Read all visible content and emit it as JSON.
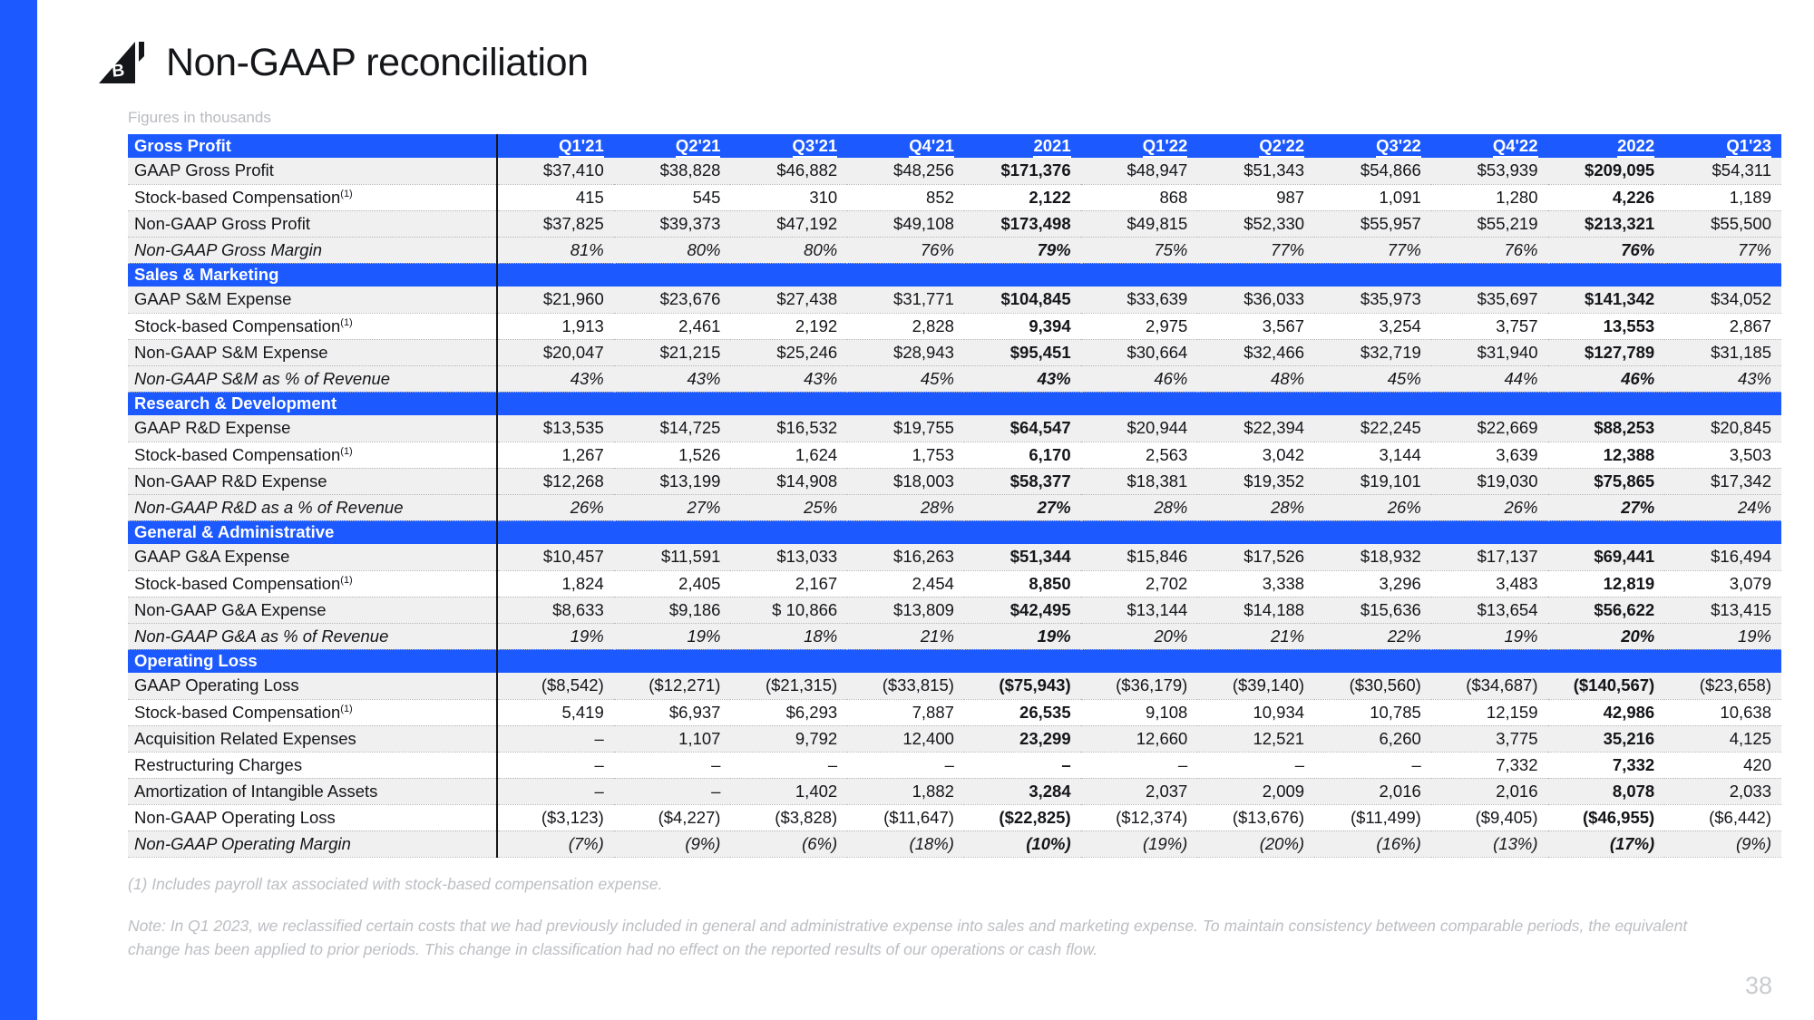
{
  "brand": {
    "accent": "#1C59FF",
    "text": "#15161A",
    "muted": "#bcbec3"
  },
  "header": {
    "title": "Non-GAAP reconciliation",
    "logo_name": "braze-logo",
    "figures_note": "Figures in thousands"
  },
  "columns": [
    "Q1'21",
    "Q2'21",
    "Q3'21",
    "Q4'21",
    "2021",
    "Q1'22",
    "Q2'22",
    "Q3'22",
    "Q4'22",
    "2022",
    "Q1'23"
  ],
  "bold_columns": [
    4,
    9
  ],
  "sections": [
    {
      "title": "Gross Profit",
      "rows": [
        {
          "label": "GAAP Gross Profit",
          "footnote": "",
          "italic": false,
          "shaded": true,
          "values": [
            "$37,410",
            "$38,828",
            "$46,882",
            "$48,256",
            "$171,376",
            "$48,947",
            "$51,343",
            "$54,866",
            "$53,939",
            "$209,095",
            "$54,311"
          ]
        },
        {
          "label": "Stock-based Compensation",
          "footnote": "(1)",
          "italic": false,
          "shaded": false,
          "values": [
            "415",
            "545",
            "310",
            "852",
            "2,122",
            "868",
            "987",
            "1,091",
            "1,280",
            "4,226",
            "1,189"
          ]
        },
        {
          "label": "Non-GAAP Gross Profit",
          "footnote": "",
          "italic": false,
          "shaded": true,
          "values": [
            "$37,825",
            "$39,373",
            "$47,192",
            "$49,108",
            "$173,498",
            "$49,815",
            "$52,330",
            "$55,957",
            "$55,219",
            "$213,321",
            "$55,500"
          ]
        },
        {
          "label": "Non-GAAP Gross Margin",
          "footnote": "",
          "italic": true,
          "shaded": true,
          "values": [
            "81%",
            "80%",
            "80%",
            "76%",
            "79%",
            "75%",
            "77%",
            "77%",
            "76%",
            "76%",
            "77%"
          ]
        }
      ]
    },
    {
      "title": "Sales & Marketing",
      "rows": [
        {
          "label": "GAAP S&M Expense",
          "footnote": "",
          "italic": false,
          "shaded": true,
          "values": [
            "$21,960",
            "$23,676",
            "$27,438",
            "$31,771",
            "$104,845",
            "$33,639",
            "$36,033",
            "$35,973",
            "$35,697",
            "$141,342",
            "$34,052"
          ]
        },
        {
          "label": "Stock-based Compensation",
          "footnote": "(1)",
          "italic": false,
          "shaded": false,
          "values": [
            "1,913",
            "2,461",
            "2,192",
            "2,828",
            "9,394",
            "2,975",
            "3,567",
            "3,254",
            "3,757",
            "13,553",
            "2,867"
          ]
        },
        {
          "label": "Non-GAAP S&M Expense",
          "footnote": "",
          "italic": false,
          "shaded": true,
          "values": [
            "$20,047",
            "$21,215",
            "$25,246",
            "$28,943",
            "$95,451",
            "$30,664",
            "$32,466",
            "$32,719",
            "$31,940",
            "$127,789",
            "$31,185"
          ]
        },
        {
          "label": "Non-GAAP S&M as % of Revenue",
          "footnote": "",
          "italic": true,
          "shaded": true,
          "values": [
            "43%",
            "43%",
            "43%",
            "45%",
            "43%",
            "46%",
            "48%",
            "45%",
            "44%",
            "46%",
            "43%"
          ]
        }
      ]
    },
    {
      "title": "Research & Development",
      "rows": [
        {
          "label": "GAAP R&D Expense",
          "footnote": "",
          "italic": false,
          "shaded": true,
          "values": [
            "$13,535",
            "$14,725",
            "$16,532",
            "$19,755",
            "$64,547",
            "$20,944",
            "$22,394",
            "$22,245",
            "$22,669",
            "$88,253",
            "$20,845"
          ]
        },
        {
          "label": "Stock-based Compensation",
          "footnote": "(1)",
          "italic": false,
          "shaded": false,
          "values": [
            "1,267",
            "1,526",
            "1,624",
            "1,753",
            "6,170",
            "2,563",
            "3,042",
            "3,144",
            "3,639",
            "12,388",
            "3,503"
          ]
        },
        {
          "label": "Non-GAAP R&D Expense",
          "footnote": "",
          "italic": false,
          "shaded": true,
          "values": [
            "$12,268",
            "$13,199",
            "$14,908",
            "$18,003",
            "$58,377",
            "$18,381",
            "$19,352",
            "$19,101",
            "$19,030",
            "$75,865",
            "$17,342"
          ]
        },
        {
          "label": "Non-GAAP R&D as a % of Revenue",
          "footnote": "",
          "italic": true,
          "shaded": true,
          "values": [
            "26%",
            "27%",
            "25%",
            "28%",
            "27%",
            "28%",
            "28%",
            "26%",
            "26%",
            "27%",
            "24%"
          ]
        }
      ]
    },
    {
      "title": "General & Administrative",
      "rows": [
        {
          "label": "GAAP G&A Expense",
          "footnote": "",
          "italic": false,
          "shaded": true,
          "values": [
            "$10,457",
            "$11,591",
            "$13,033",
            "$16,263",
            "$51,344",
            "$15,846",
            "$17,526",
            "$18,932",
            "$17,137",
            "$69,441",
            "$16,494"
          ]
        },
        {
          "label": "Stock-based Compensation",
          "footnote": "(1)",
          "italic": false,
          "shaded": false,
          "values": [
            "1,824",
            "2,405",
            "2,167",
            "2,454",
            "8,850",
            "2,702",
            "3,338",
            "3,296",
            "3,483",
            "12,819",
            "3,079"
          ]
        },
        {
          "label": "Non-GAAP G&A Expense",
          "footnote": "",
          "italic": false,
          "shaded": true,
          "values": [
            "$8,633",
            "$9,186",
            "$ 10,866",
            "$13,809",
            "$42,495",
            "$13,144",
            "$14,188",
            "$15,636",
            "$13,654",
            "$56,622",
            "$13,415"
          ]
        },
        {
          "label": "Non-GAAP G&A as % of Revenue",
          "footnote": "",
          "italic": true,
          "shaded": true,
          "values": [
            "19%",
            "19%",
            "18%",
            "21%",
            "19%",
            "20%",
            "21%",
            "22%",
            "19%",
            "20%",
            "19%"
          ]
        }
      ]
    },
    {
      "title": "Operating Loss",
      "rows": [
        {
          "label": "GAAP Operating Loss",
          "footnote": "",
          "italic": false,
          "shaded": true,
          "values": [
            "($8,542)",
            "($12,271)",
            "($21,315)",
            "($33,815)",
            "($75,943)",
            "($36,179)",
            "($39,140)",
            "($30,560)",
            "($34,687)",
            "($140,567)",
            "($23,658)"
          ]
        },
        {
          "label": "Stock-based Compensation",
          "footnote": "(1)",
          "italic": false,
          "shaded": false,
          "values": [
            "5,419",
            "$6,937",
            "$6,293",
            "7,887",
            "26,535",
            "9,108",
            "10,934",
            "10,785",
            "12,159",
            "42,986",
            "10,638"
          ]
        },
        {
          "label": "Acquisition Related Expenses",
          "footnote": "",
          "italic": false,
          "shaded": true,
          "values": [
            "–",
            "1,107",
            "9,792",
            "12,400",
            "23,299",
            "12,660",
            "12,521",
            "6,260",
            "3,775",
            "35,216",
            "4,125"
          ]
        },
        {
          "label": "Restructuring Charges",
          "footnote": "",
          "italic": false,
          "shaded": false,
          "values": [
            "–",
            "–",
            "–",
            "–",
            "–",
            "–",
            "–",
            "–",
            "7,332",
            "7,332",
            "420"
          ]
        },
        {
          "label": "Amortization of Intangible Assets",
          "footnote": "",
          "italic": false,
          "shaded": true,
          "values": [
            "–",
            "–",
            "1,402",
            "1,882",
            "3,284",
            "2,037",
            "2,009",
            "2,016",
            "2,016",
            "8,078",
            "2,033"
          ]
        },
        {
          "label": "Non-GAAP Operating Loss",
          "footnote": "",
          "italic": false,
          "shaded": false,
          "values": [
            "($3,123)",
            "($4,227)",
            "($3,828)",
            "($11,647)",
            "($22,825)",
            "($12,374)",
            "($13,676)",
            "($11,499)",
            "($9,405)",
            "($46,955)",
            "($6,442)"
          ]
        },
        {
          "label": "Non-GAAP Operating Margin",
          "footnote": "",
          "italic": true,
          "shaded": true,
          "values": [
            "(7%)",
            "(9%)",
            "(6%)",
            "(18%)",
            "(10%)",
            "(19%)",
            "(20%)",
            "(16%)",
            "(13%)",
            "(17%)",
            "(9%)"
          ]
        }
      ]
    }
  ],
  "footnotes": {
    "fn1": "(1) Includes payroll tax associated with stock-based compensation expense.",
    "note": "Note: In Q1 2023, we reclassified certain costs that we had previously included in general and administrative expense into sales and marketing expense. To maintain consistency between comparable periods, the equivalent change has been applied to prior periods. This change in classification had no effect on the reported results of our operations or cash flow."
  },
  "page_number": "38"
}
